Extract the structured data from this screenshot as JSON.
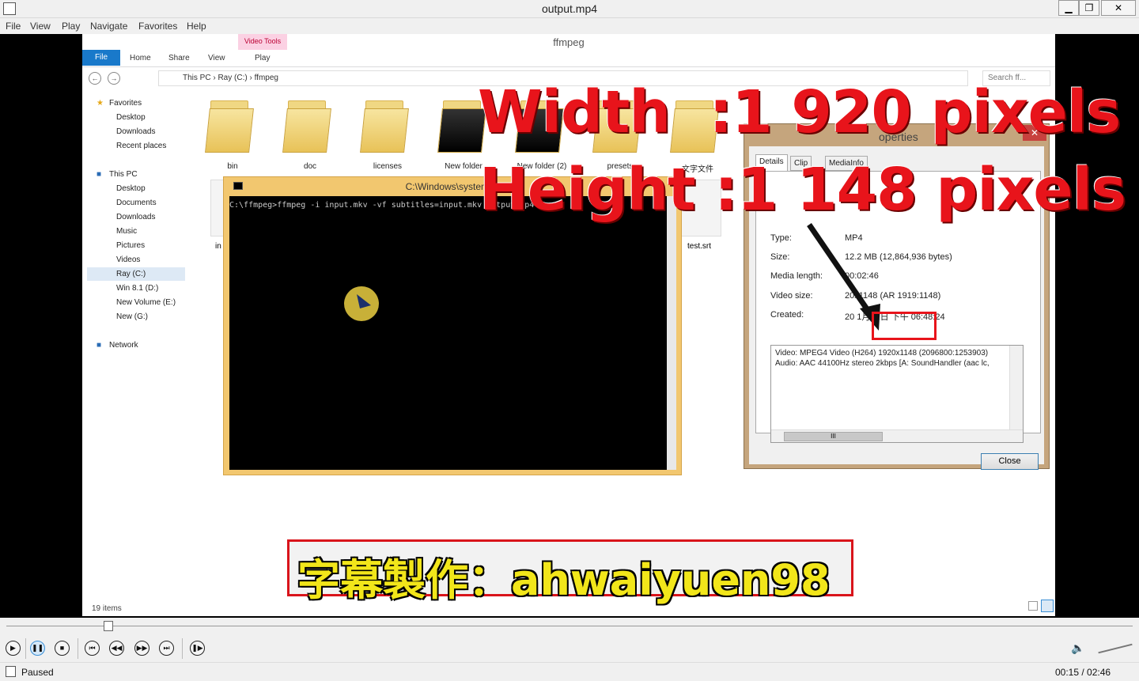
{
  "window": {
    "title": "output.mp4",
    "min": "▁",
    "restore": "❐",
    "close": "✕"
  },
  "menu": [
    "File",
    "View",
    "Play",
    "Navigate",
    "Favorites",
    "Help"
  ],
  "explorer": {
    "title": "ffmpeg",
    "contextual_tab": "Video Tools",
    "tabs": [
      "File",
      "Home",
      "Share",
      "View",
      "Play"
    ],
    "breadcrumb": [
      "This PC",
      "Ray (C:)",
      "ffmpeg"
    ],
    "search_placeholder": "Search ff...",
    "nav": {
      "favorites": "Favorites",
      "fav_items": [
        "Desktop",
        "Downloads",
        "Recent places"
      ],
      "thispc": "This PC",
      "pc_items": [
        "Desktop",
        "Documents",
        "Downloads",
        "Music",
        "Pictures",
        "Videos",
        "Ray (C:)",
        "Win 8.1 (D:)",
        "New Volume (E:)",
        "New (G:)"
      ],
      "network": "Network"
    },
    "folders": [
      "bin",
      "doc",
      "licenses",
      "New folder",
      "New folder (2)",
      "presets",
      "文字文件"
    ],
    "second_row": [
      "in",
      "test.srt"
    ],
    "item_count": "19 items"
  },
  "console": {
    "title": "C:\\Windows\\system32",
    "command": "C:\\ffmpeg>ffmpeg -i input.mkv -vf subtitles=input.mkv output.mp4"
  },
  "properties": {
    "title": "operties",
    "tabs": [
      "Details",
      "Clip",
      "MediaInfo"
    ],
    "rows": [
      {
        "label": "Type:",
        "value": "MP4"
      },
      {
        "label": "Size:",
        "value": "12.2 MB (12,864,936 bytes)"
      },
      {
        "label": "Media length:",
        "value": "00:02:46"
      },
      {
        "label": "Video size:",
        "value": "20x1148 (AR 1919:1148)"
      },
      {
        "label": "Created:",
        "value": "20  1月21日 下午 06:48:24"
      }
    ],
    "info_lines": [
      "Video: MPEG4 Video (H264) 1920x1148 (2096800:1253903)",
      "Audio: AAC 44100Hz stereo 2kbps [A: SoundHandler (aac lc,"
    ],
    "close_label": "Close"
  },
  "overlay": {
    "width_text": "Width  :1 920 pixels",
    "height_text": "Height :1 148 pixels",
    "subtitle": "字幕製作：ahwaiyuen98"
  },
  "player": {
    "status": "Paused",
    "time": "00:15 / 02:46",
    "progress_fraction": 0.09
  },
  "colors": {
    "overlay_red": "#e8141b",
    "subtitle_yellow": "#f2e61a",
    "file_tab": "#1979ca"
  }
}
